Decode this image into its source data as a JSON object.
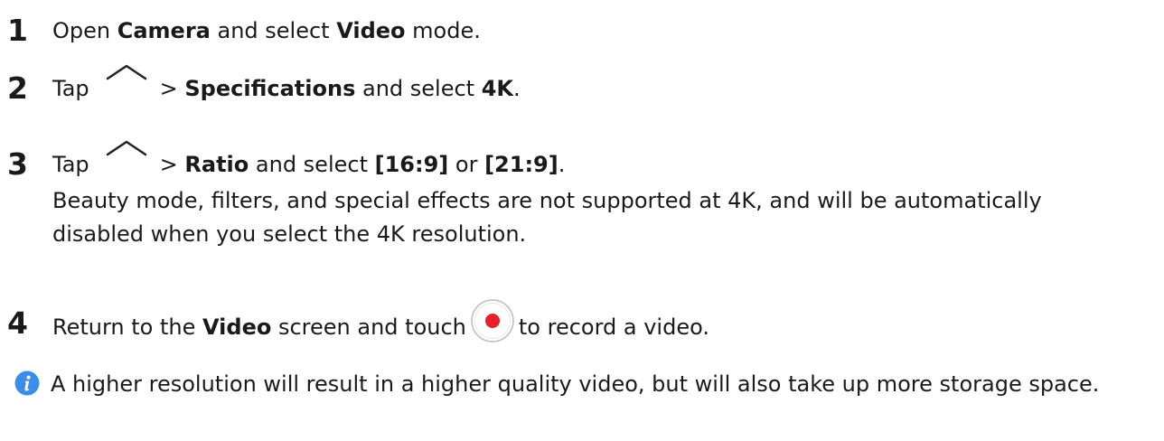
{
  "steps": [
    {
      "number": "1",
      "t1": "Open ",
      "b1": "Camera",
      "t2": " and select ",
      "b2": "Video",
      "t3": " mode."
    },
    {
      "number": "2",
      "t1": "Tap",
      "t2": "> ",
      "b1": "Specifications",
      "t3": " and select ",
      "b2": "4K",
      "t4": "."
    },
    {
      "number": "3",
      "t1": "Tap",
      "t2": "> ",
      "b1": "Ratio",
      "t3": " and select ",
      "b2": "[16:9]",
      "t4": " or ",
      "b3": "[21:9]",
      "t5": ".",
      "description": "Beauty mode, filters, and special effects are not supported at 4K, and will be automatically disabled when you select the 4K resolution."
    },
    {
      "number": "4",
      "t1": "Return to the ",
      "b1": "Video",
      "t2": " screen and touch",
      "t3": "to record a video."
    }
  ],
  "note": {
    "text": "A higher resolution will result in a higher quality video, but will also take up more storage space."
  },
  "icons": {
    "chevron": "chevron-up-icon",
    "record": "record-button-icon",
    "info": "info-icon"
  },
  "colors": {
    "text": "#1a1a1a",
    "record_red": "#e8202a",
    "info_blue": "#3a8ee8"
  }
}
